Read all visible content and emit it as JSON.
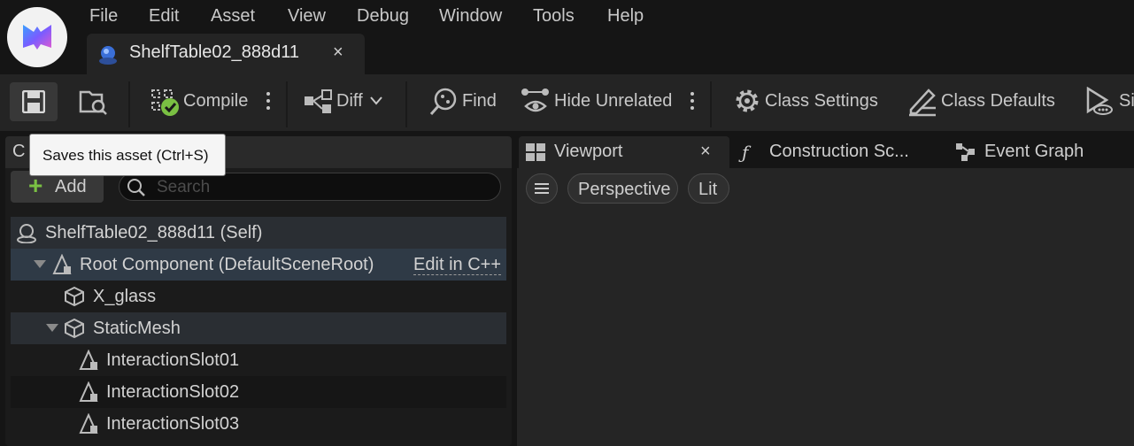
{
  "menu": {
    "items": [
      "File",
      "Edit",
      "Asset",
      "View",
      "Debug",
      "Window",
      "Tools",
      "Help"
    ]
  },
  "document_tab": {
    "title": "ShelfTable02_888d11",
    "close": "×"
  },
  "toolbar": {
    "compile_label": "Compile",
    "diff_label": "Diff",
    "find_label": "Find",
    "hide_unrelated_label": "Hide Unrelated",
    "class_settings_label": "Class Settings",
    "class_defaults_label": "Class Defaults",
    "simulate_label": "Si"
  },
  "tooltip": {
    "text": "Saves this asset (Ctrl+S)"
  },
  "components": {
    "header_letter": "C",
    "add_label": "Add",
    "search_placeholder": "Search",
    "self_row": "ShelfTable02_888d11 (Self)",
    "root_row": "Root Component (DefaultSceneRoot)",
    "edit_cpp": "Edit in C++",
    "items": [
      "X_glass",
      "StaticMesh",
      "InteractionSlot01",
      "InteractionSlot02",
      "InteractionSlot03"
    ]
  },
  "viewport_tabs": {
    "viewport": "Viewport",
    "viewport_close": "×",
    "construction": "Construction Sc...",
    "event_graph": "Event Graph"
  },
  "viewport_controls": {
    "menu_icon": "hamburger-icon",
    "perspective": "Perspective",
    "lit": "Lit"
  },
  "colors": {
    "accent_green": "#7ac043",
    "background": "#151515",
    "panel": "#242424",
    "selected_row": "#2f3a46"
  }
}
